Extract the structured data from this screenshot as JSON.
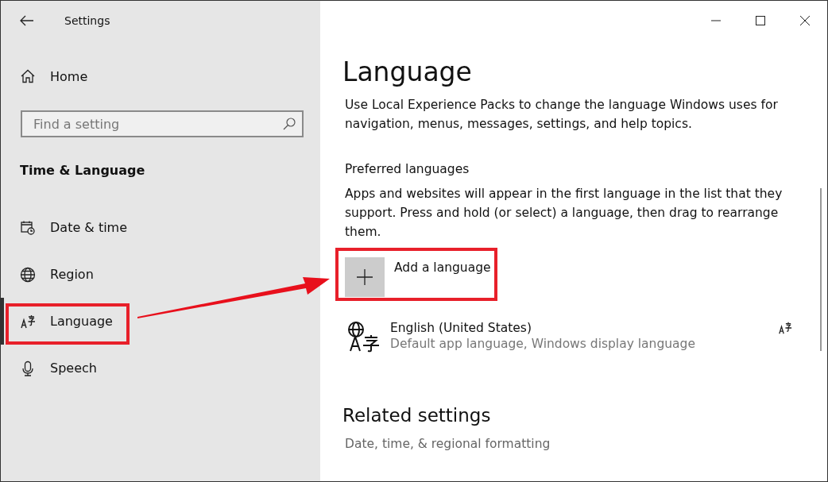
{
  "window": {
    "title": "Settings"
  },
  "sidebar": {
    "home": "Home",
    "search": {
      "placeholder": "Find a setting"
    },
    "section": "Time & Language",
    "items": [
      {
        "label": "Date & time",
        "kind": "calendar",
        "selected": false,
        "highlighted": false
      },
      {
        "label": "Region",
        "kind": "globe",
        "selected": false,
        "highlighted": false
      },
      {
        "label": "Language",
        "kind": "language",
        "selected": true,
        "highlighted": true
      },
      {
        "label": "Speech",
        "kind": "microphone",
        "selected": false,
        "highlighted": false
      }
    ]
  },
  "page": {
    "title": "Language",
    "intro": "Use Local Experience Packs to change the language Windows uses for navigation, menus, messages, settings, and help topics.",
    "preferred": {
      "heading": "Preferred languages",
      "description": "Apps and websites will appear in the first language in the list that they support. Press and hold (or select) a language, then drag to rearrange them.",
      "add_button": {
        "label": "Add a language",
        "highlighted": true
      },
      "languages": [
        {
          "name": "English (United States)",
          "detail": "Default app language, Windows display language"
        }
      ]
    },
    "related": {
      "heading": "Related settings",
      "links": [
        "Date, time, & regional formatting"
      ]
    }
  },
  "annotation": {
    "arrow": true
  }
}
